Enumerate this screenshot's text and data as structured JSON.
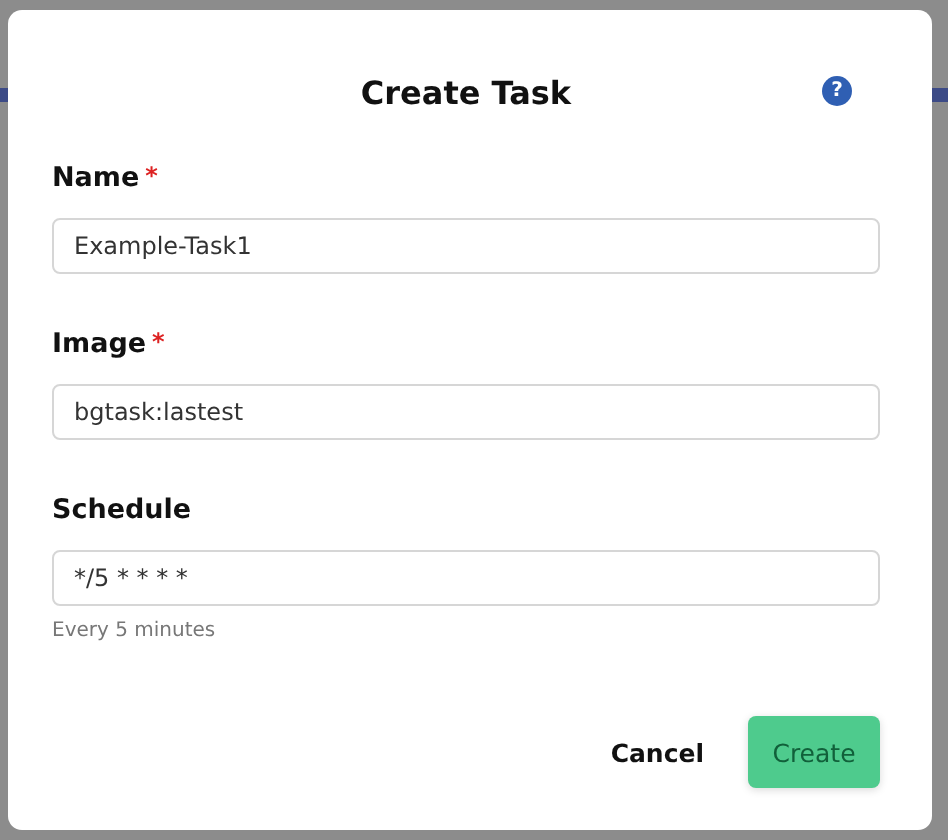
{
  "dialog": {
    "title": "Create Task",
    "help_icon": "?"
  },
  "fields": [
    {
      "label": "Name",
      "required_mark": "*",
      "value": "Example-Task1"
    },
    {
      "label": "Image",
      "required_mark": "*",
      "value": "bgtask:lastest"
    },
    {
      "label": "Schedule",
      "value": "*/5 * * * *",
      "hint": "Every 5 minutes"
    }
  ],
  "buttons": [
    {
      "label": "Cancel",
      "kind": "secondary"
    },
    {
      "label": "Create",
      "kind": "primary"
    }
  ]
}
